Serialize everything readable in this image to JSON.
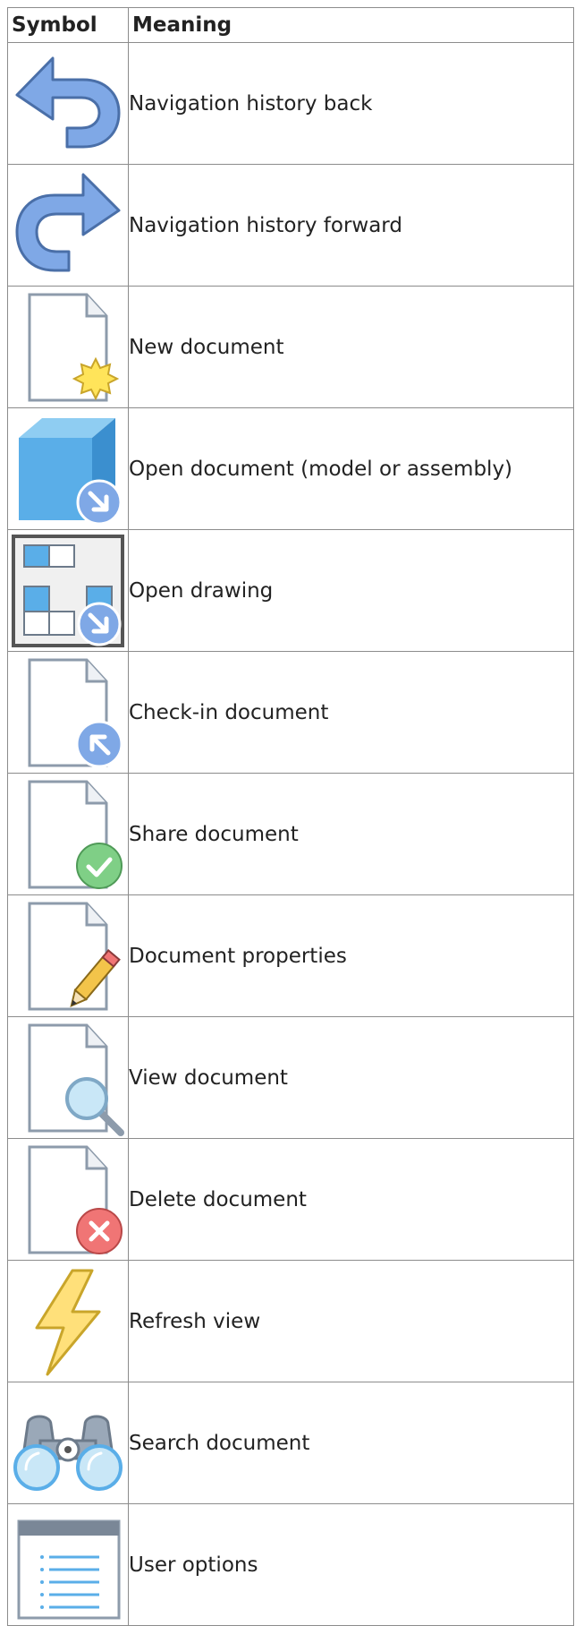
{
  "table": {
    "headers": {
      "symbol": "Symbol",
      "meaning": "Meaning"
    },
    "rows": [
      {
        "icon": "arrow-back-icon",
        "meaning": "Navigation history back"
      },
      {
        "icon": "arrow-forward-icon",
        "meaning": "Navigation history forward"
      },
      {
        "icon": "new-document-icon",
        "meaning": "New document"
      },
      {
        "icon": "open-model-icon",
        "meaning": "Open document (model or assembly)"
      },
      {
        "icon": "open-drawing-icon",
        "meaning": "Open drawing"
      },
      {
        "icon": "check-in-document-icon",
        "meaning": "Check-in document"
      },
      {
        "icon": "share-document-icon",
        "meaning": "Share document"
      },
      {
        "icon": "document-properties-icon",
        "meaning": "Document properties"
      },
      {
        "icon": "view-document-icon",
        "meaning": "View document"
      },
      {
        "icon": "delete-document-icon",
        "meaning": "Delete document"
      },
      {
        "icon": "refresh-lightning-icon",
        "meaning": "Refresh view"
      },
      {
        "icon": "binoculars-icon",
        "meaning": "Search document"
      },
      {
        "icon": "user-options-icon",
        "meaning": "User options"
      }
    ]
  },
  "colors": {
    "border": "#8c8c8c",
    "blue_fill": "#7fa8e6",
    "blue_stroke": "#4a6fa8",
    "doc_stroke": "#8d9bab",
    "badge_yellow": "#ffe45a",
    "badge_green": "#7fcf86",
    "badge_red": "#f07575",
    "cube_blue": "#5aaee8"
  }
}
